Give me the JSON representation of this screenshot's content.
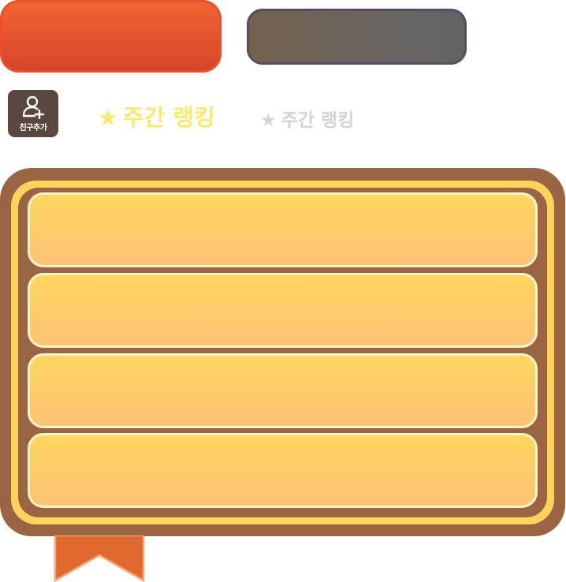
{
  "top_buttons": {
    "primary_color": "#f26532",
    "secondary_color": "#6a6560"
  },
  "add_friend": {
    "label": "친구추가",
    "icon": "add-user-icon"
  },
  "tabs": [
    {
      "star": "★",
      "label": "주간 랭킹",
      "active": true,
      "color": "#fbe870"
    },
    {
      "star": "★",
      "label": "주간 랭킹",
      "active": false,
      "color": "#d3d3d3"
    }
  ],
  "board": {
    "frame_color": "#9b6442",
    "trim_color": "#ffd25b",
    "slot_count": 4
  },
  "ribbon": {
    "color": "#e06a2e"
  }
}
